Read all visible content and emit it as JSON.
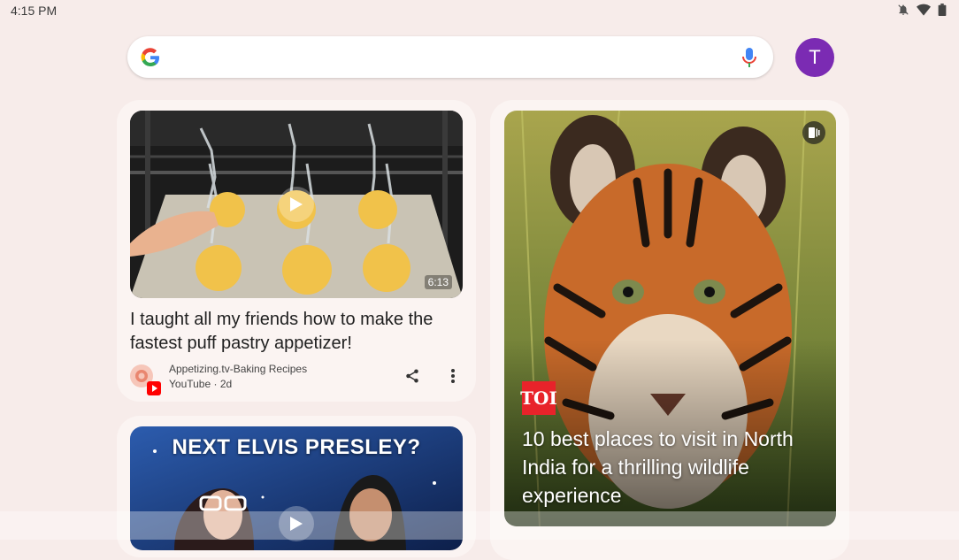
{
  "status": {
    "time": "4:15 PM",
    "icons": [
      "notifications-off-icon",
      "wifi-icon",
      "battery-icon"
    ]
  },
  "search": {
    "placeholder": "",
    "logo": "google-g-icon",
    "voice": "mic-icon"
  },
  "account": {
    "initial": "T",
    "color": "#7b2bb3"
  },
  "feed": {
    "cards": [
      {
        "type": "video",
        "duration": "6:13",
        "title": "I taught all my friends how to make the fastest puff pastry appetizer!",
        "source": "Appetizing.tv-Baking Recipes",
        "meta": "YouTube · 2d",
        "actions": [
          "share-icon",
          "more-vert-icon"
        ]
      },
      {
        "type": "video",
        "thumbnail_text": "NEXT ELVIS PRESLEY?"
      },
      {
        "type": "story",
        "publisher": "TOI",
        "title": "10 best places to visit in North India for a thrilling wildlife experience"
      }
    ]
  },
  "colors": {
    "background": "#f7ecea",
    "card": "#fbf4f2",
    "toi_red": "#e8232a",
    "youtube_red": "#ff0000"
  }
}
